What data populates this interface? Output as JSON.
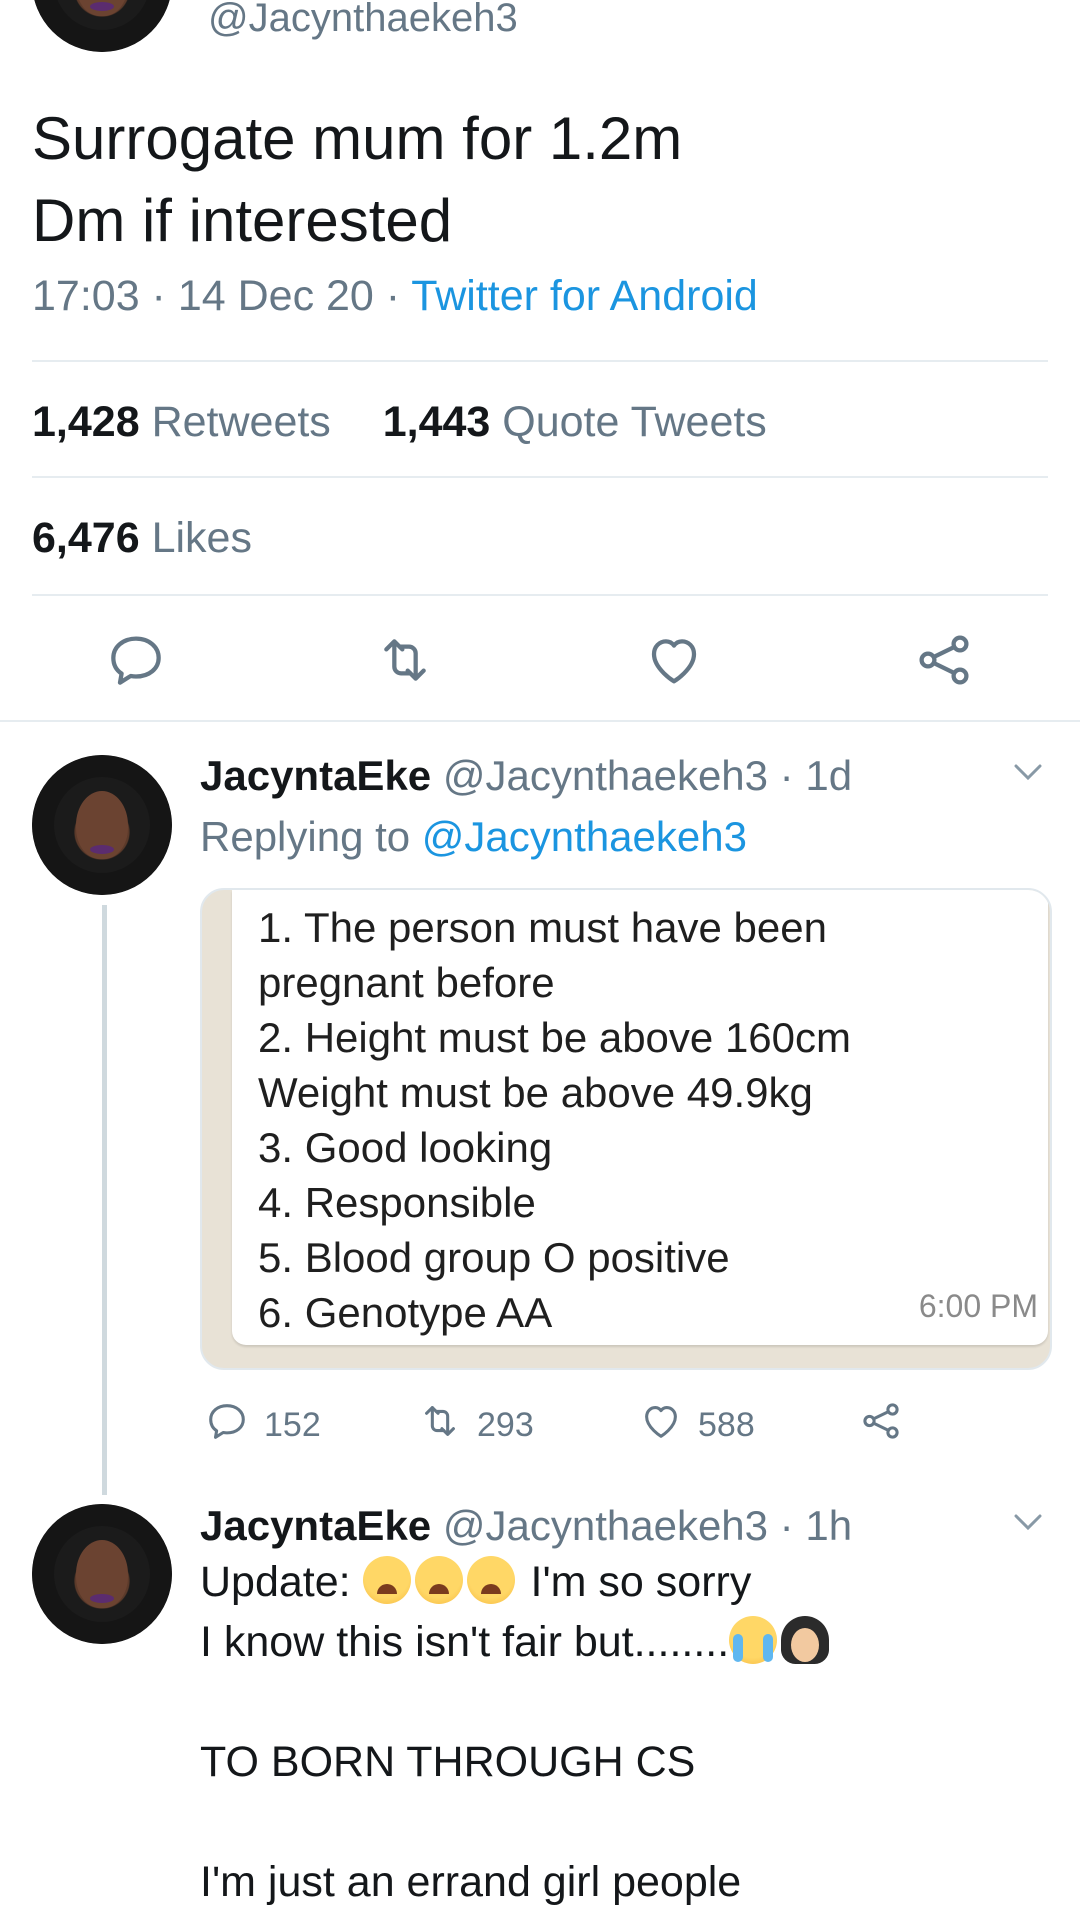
{
  "main_tweet": {
    "handle": "@Jacynthaekeh3",
    "text_line1": "Surrogate mum for 1.2m",
    "text_line2": "Dm if interested",
    "time": "17:03",
    "sep1": " · ",
    "date": "14 Dec 20",
    "sep2": " · ",
    "source": "Twitter for Android",
    "retweets_count": "1,428",
    "retweets_label": "Retweets",
    "quotes_count": "1,443",
    "quotes_label": "Quote Tweets",
    "likes_count": "6,476",
    "likes_label": "Likes"
  },
  "reply1": {
    "name": "JacyntaEke",
    "handle": "@Jacynthaekeh3",
    "age": " · 1d",
    "replying_prefix": "Replying to ",
    "replying_handle": "@Jacynthaekeh3",
    "image_lines": [
      "1. The person must have been",
      "pregnant before",
      "2. Height must be above 160cm",
      "Weight must be above 49.9kg",
      "3. Good looking",
      "4. Responsible",
      "5. Blood group O positive",
      "6. Genotype AA"
    ],
    "image_time": "6:00 PM",
    "replies": "152",
    "retweets": "293",
    "likes": "588"
  },
  "reply2": {
    "name": "JacyntaEke",
    "handle": "@Jacynthaekeh3",
    "age": " · 1h",
    "line1_a": "Update: ",
    "line1_b": " I'm so sorry",
    "line2": "I know this isn't fair but........",
    "line3": "TO BORN THROUGH CS",
    "line4": "I'm just an errand girl people"
  },
  "icons": {
    "reply": "reply-icon",
    "retweet": "retweet-icon",
    "like": "heart-icon",
    "share": "share-icon",
    "more": "chevron-down-icon"
  },
  "colors": {
    "link": "#1b95e0",
    "muted": "#657786",
    "text": "#14171a"
  }
}
